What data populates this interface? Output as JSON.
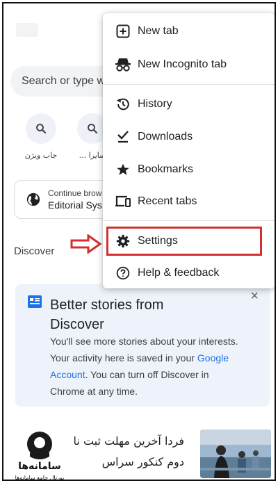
{
  "search": {
    "placeholder": "Search or type w"
  },
  "shortcuts": [
    {
      "label": "جاب ویژن",
      "icon": "search-icon"
    },
    {
      "label": "... سایرا",
      "icon": "search-icon"
    }
  ],
  "continue_card": {
    "line1": "Continue brow",
    "line2": "Editorial Sys",
    "icon": "globe-icon"
  },
  "discover": {
    "label": "Discover"
  },
  "promo": {
    "title": "Better stories from Discover",
    "body_part1": "You'll see more stories about your interests. Your activity here is saved in your ",
    "body_link": "Google Account",
    "body_part2": ". You can turn off Discover in Chrome at any time.",
    "close_glyph": "×"
  },
  "news": {
    "line1": "فردا آخرین مهلت ثبت نا",
    "line2": "دوم کنکور سراس"
  },
  "watermark": {
    "title": "سامانه‌ها",
    "subtitle": "پورتال جامع سامانه‌ها"
  },
  "menu": {
    "items": [
      {
        "label": "New tab",
        "icon": "new-tab-icon"
      },
      {
        "label": "New Incognito tab",
        "icon": "incognito-icon"
      },
      {
        "label": "History",
        "icon": "history-icon"
      },
      {
        "label": "Downloads",
        "icon": "downloads-icon"
      },
      {
        "label": "Bookmarks",
        "icon": "star-icon"
      },
      {
        "label": "Recent tabs",
        "icon": "devices-icon"
      },
      {
        "label": "Settings",
        "icon": "gear-icon",
        "highlighted": true
      },
      {
        "label": "Help & feedback",
        "icon": "help-icon"
      }
    ]
  },
  "colors": {
    "highlight": "#d32f2f",
    "link": "#1a73e8",
    "card_bg": "#eef3fb"
  }
}
